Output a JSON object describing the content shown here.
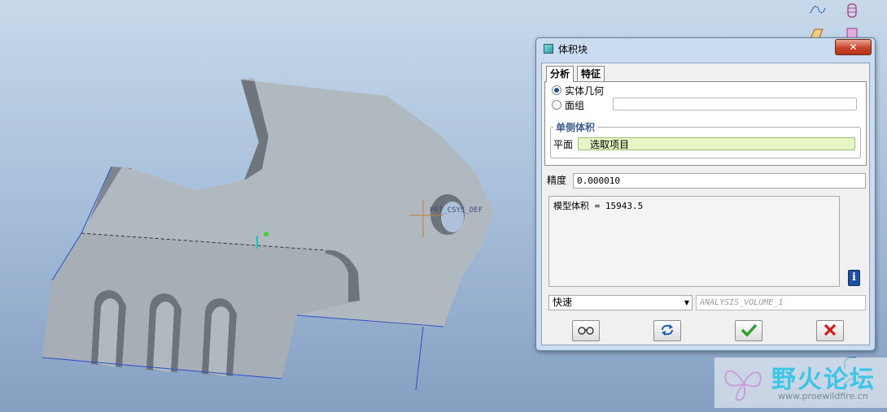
{
  "viewport": {
    "csys_label": "PRT_CSYS_DEF"
  },
  "dialog": {
    "title": "体积块",
    "close_symbol": "✕",
    "tabs": [
      {
        "label": "分析",
        "active": true
      },
      {
        "label": "特征",
        "active": false
      }
    ],
    "options": {
      "solid_geometry": "实体几何",
      "quilt": "面组",
      "selected": "solid_geometry"
    },
    "one_side_volume": {
      "title": "单侧体积",
      "plane_label": "平面",
      "select_prompt": "选取项目"
    },
    "precision": {
      "label": "精度",
      "value": "0.000010"
    },
    "result": "模型体积 = 15943.5",
    "info_symbol": "i",
    "mode_select": {
      "value": "快速"
    },
    "analysis_name": "ANALYSIS_VOLUME_1",
    "buttons": [
      {
        "name": "preview",
        "icon": "glasses-icon"
      },
      {
        "name": "repeat",
        "icon": "refresh-icon"
      },
      {
        "name": "ok",
        "icon": "checkmark-icon"
      },
      {
        "name": "cancel",
        "icon": "x-icon"
      }
    ],
    "colors": {
      "accept": "#2fa02f",
      "cancel": "#d11a1a",
      "section_title": "#3b5e8c",
      "select_field": "#e4f7c4"
    }
  },
  "watermark": {
    "title": "野火论坛",
    "url": "www.proewildfire.cn"
  }
}
